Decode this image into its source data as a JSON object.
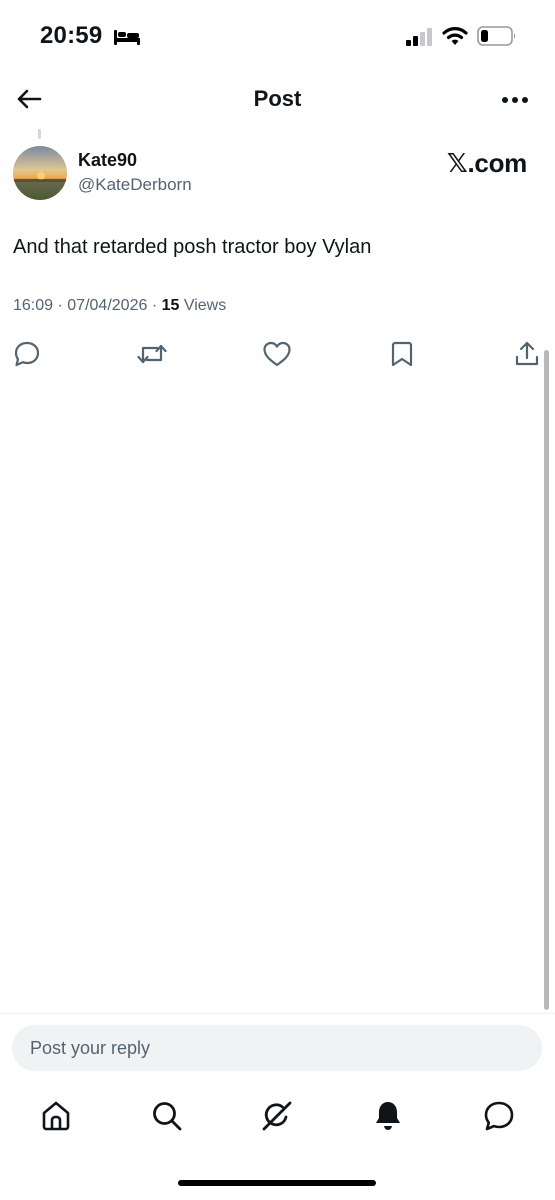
{
  "status_bar": {
    "time": "20:59",
    "sleep_icon": "bed-icon",
    "signal_icon": "cellular-signal-icon",
    "wifi_icon": "wifi-icon",
    "battery_icon": "battery-icon",
    "battery_level": 0.25
  },
  "header": {
    "title": "Post",
    "back_icon": "arrow-left-icon",
    "more_icon": "more-horizontal-icon"
  },
  "post": {
    "display_name": "Kate90",
    "handle": "@KateDerborn",
    "source_badge": "𝕏.com",
    "text": "And that retarded posh tractor boy Vylan",
    "time": "16:09",
    "date": "07/04/2026",
    "separator": "·",
    "views_count": "15",
    "views_label": "Views",
    "actions": [
      {
        "name": "reply",
        "icon": "reply-icon"
      },
      {
        "name": "repost",
        "icon": "repost-icon"
      },
      {
        "name": "like",
        "icon": "heart-icon"
      },
      {
        "name": "bookmark",
        "icon": "bookmark-icon"
      },
      {
        "name": "share",
        "icon": "share-icon"
      }
    ]
  },
  "reply": {
    "placeholder": "Post your reply"
  },
  "tab_bar": {
    "items": [
      {
        "name": "home",
        "icon": "home-icon"
      },
      {
        "name": "search",
        "icon": "search-icon"
      },
      {
        "name": "grok",
        "icon": "grok-icon"
      },
      {
        "name": "notifications",
        "icon": "bell-icon"
      },
      {
        "name": "messages",
        "icon": "message-bubble-icon"
      }
    ]
  },
  "colors": {
    "text_primary": "#0f1419",
    "text_secondary": "#536471",
    "reply_bg": "#eff3f4",
    "icon": "#536471"
  }
}
